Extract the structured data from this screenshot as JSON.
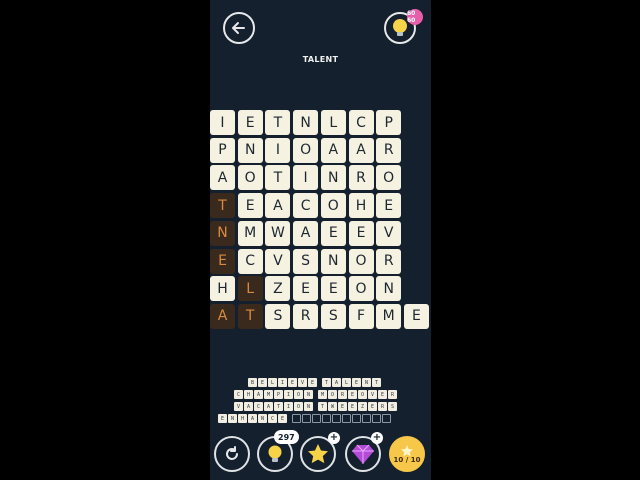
{
  "header": {
    "title": "TALENT",
    "hint_badge": "60 60"
  },
  "grid": {
    "rows": [
      [
        "I",
        "E",
        "T",
        "N",
        "L",
        "C",
        "P"
      ],
      [
        "P",
        "N",
        "I",
        "O",
        "A",
        "A",
        "R"
      ],
      [
        "A",
        "O",
        "T",
        "I",
        "N",
        "R",
        "O"
      ],
      [
        "T",
        "E",
        "A",
        "C",
        "O",
        "H",
        "E"
      ],
      [
        "N",
        "M",
        "W",
        "A",
        "E",
        "E",
        "V"
      ],
      [
        "E",
        "C",
        "V",
        "S",
        "N",
        "O",
        "R"
      ],
      [
        "H",
        "L",
        "Z",
        "E",
        "E",
        "O",
        "N"
      ],
      [
        "A",
        "T",
        "S",
        "R",
        "S",
        "F",
        "M",
        "E"
      ]
    ],
    "found_cells": [
      [
        3,
        0
      ],
      [
        4,
        0
      ],
      [
        5,
        0
      ],
      [
        6,
        1
      ],
      [
        7,
        0
      ],
      [
        7,
        1
      ]
    ]
  },
  "words": [
    [
      "BELIEVE",
      "TALENT"
    ],
    [
      "CHAMPION",
      "MOREOVER"
    ],
    [
      "VACATION",
      "TWEEZERS"
    ],
    [
      "ENHANCE",
      "__________"
    ]
  ],
  "bottom": {
    "hints": "297",
    "level": "10 / 10"
  },
  "colors": {
    "found_bg": "#3a2a1e",
    "found_text": "#d98a3f",
    "tile": "#f6f2e2"
  }
}
